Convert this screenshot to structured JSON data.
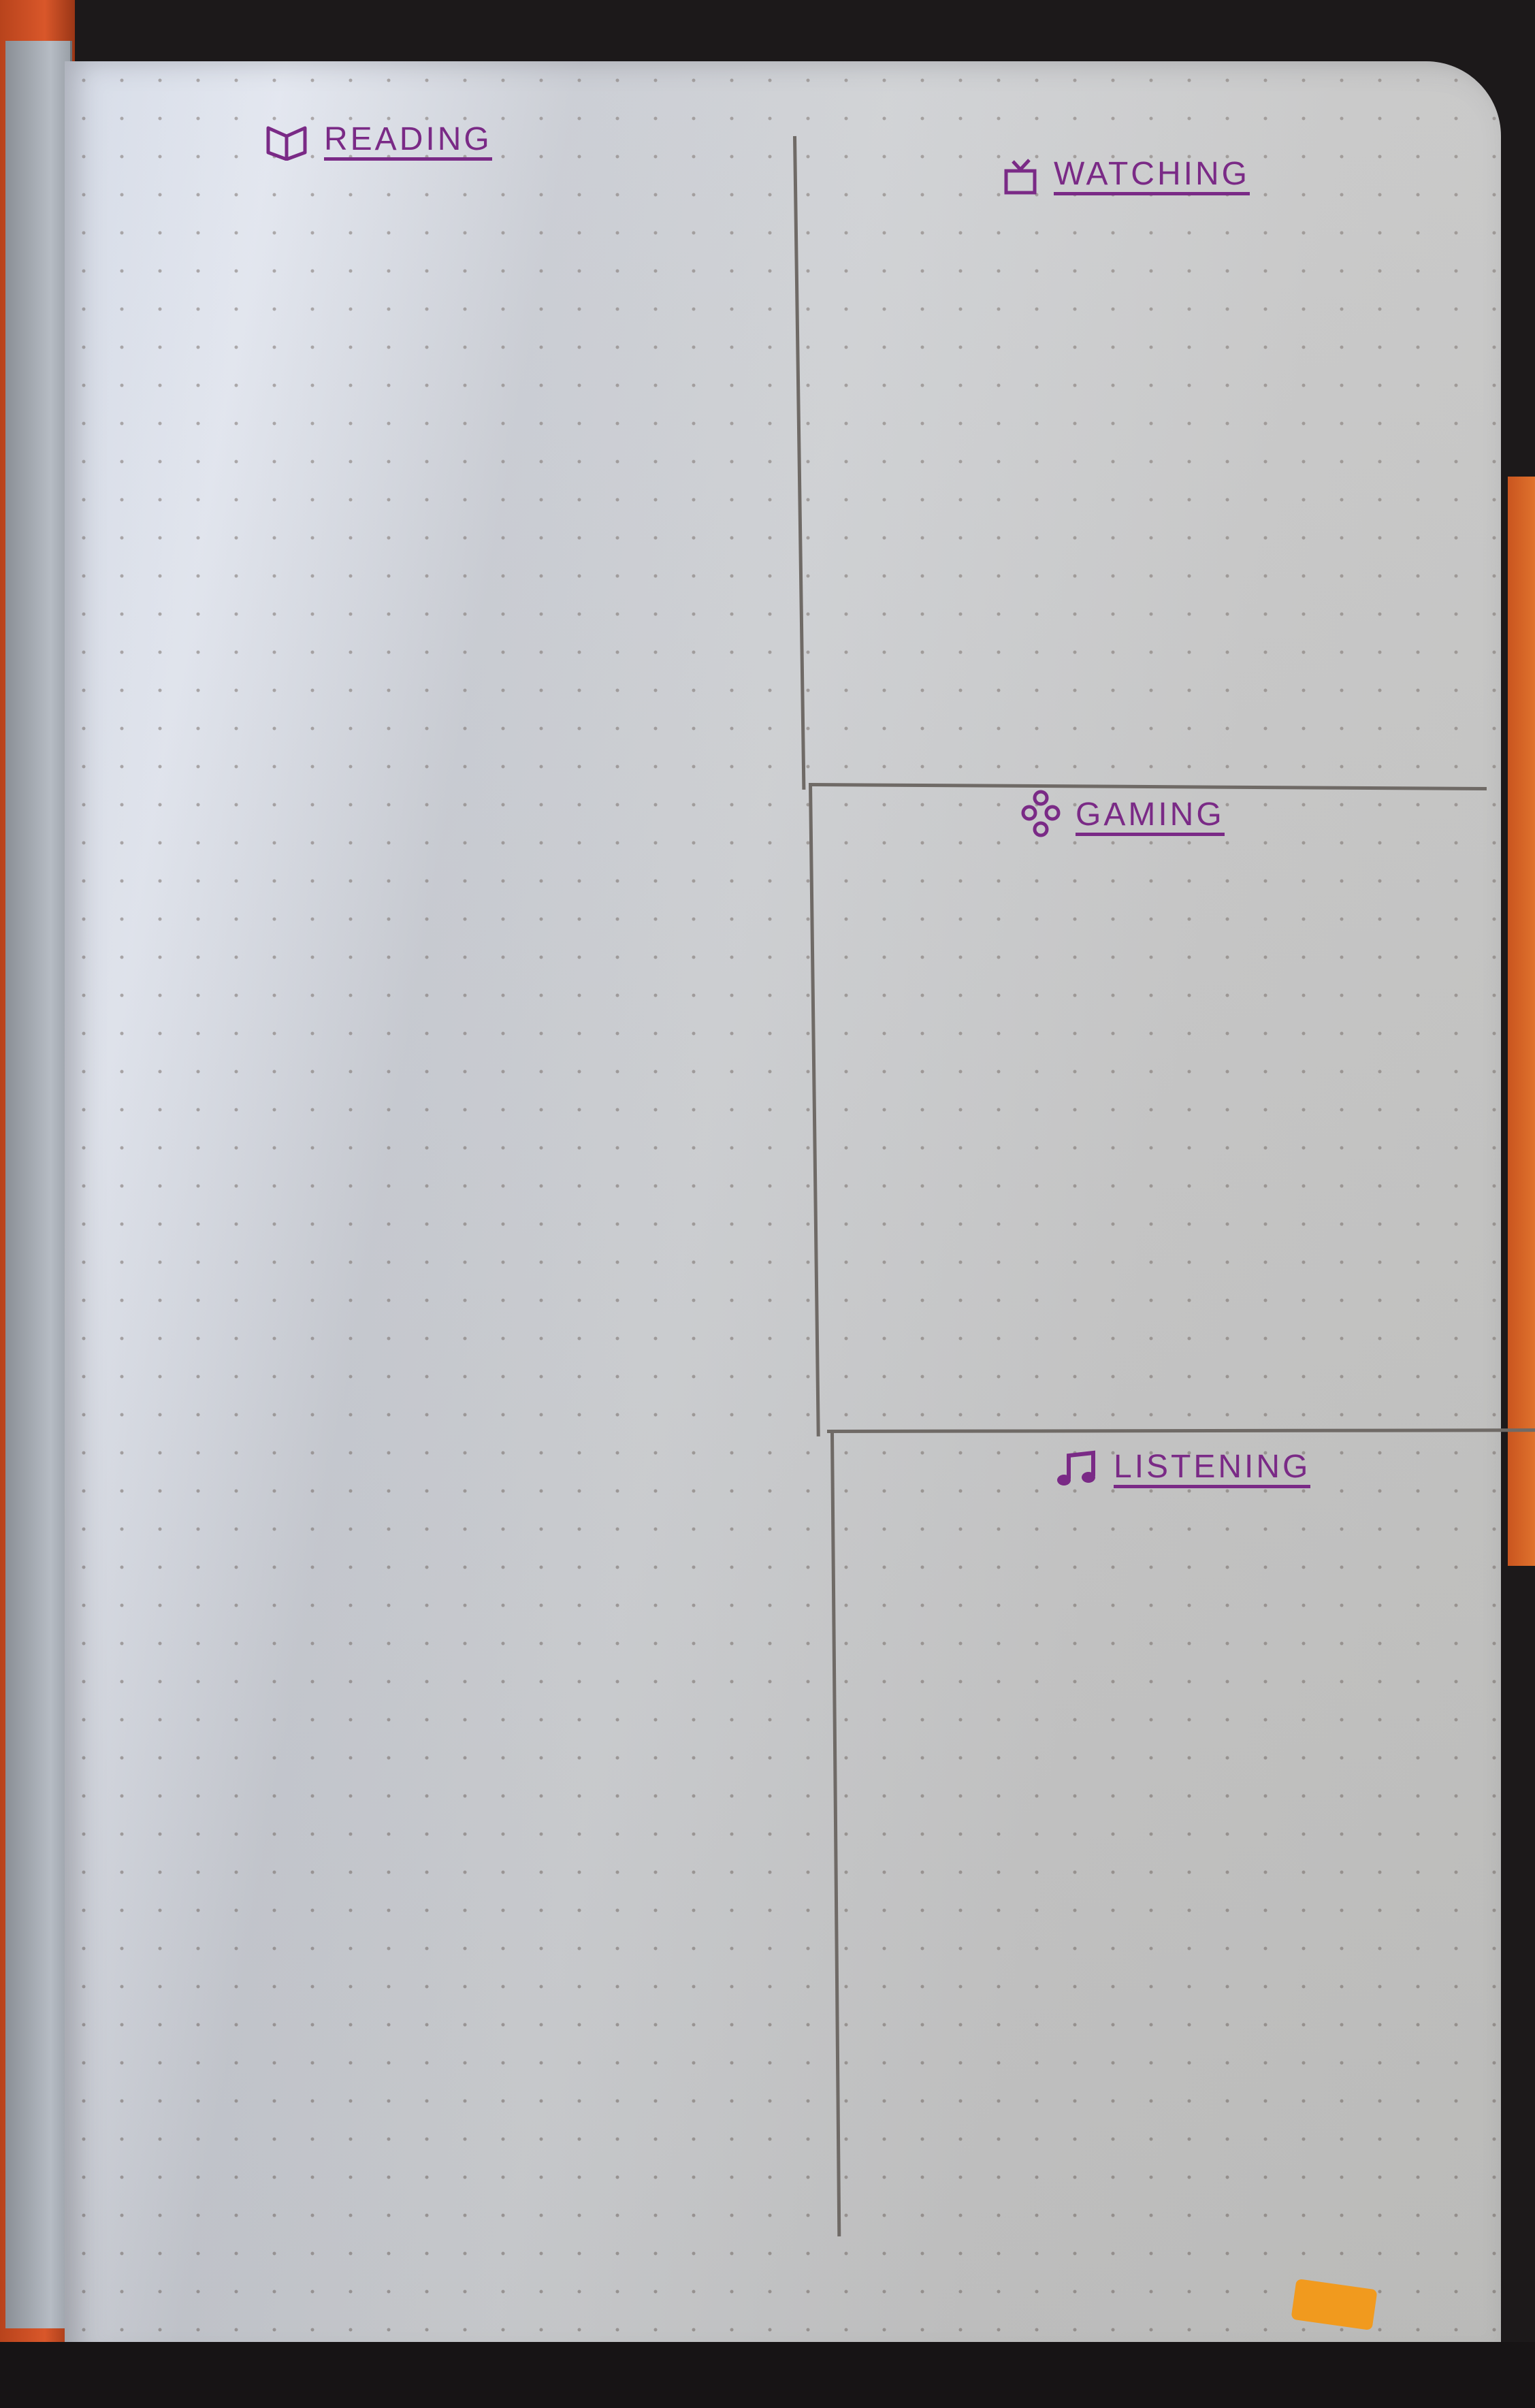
{
  "headings": {
    "reading": "Reading",
    "watching": "Watching",
    "gaming": "Gaming",
    "listening": "Listening"
  },
  "icons": {
    "reading": "open-book-icon",
    "watching": "tv-icon",
    "gaming": "gamepad-buttons-icon",
    "listening": "music-note-icon"
  },
  "colors": {
    "ink": "#7a2a86",
    "page": "#cfd1d4",
    "cover": "#d9572a"
  }
}
